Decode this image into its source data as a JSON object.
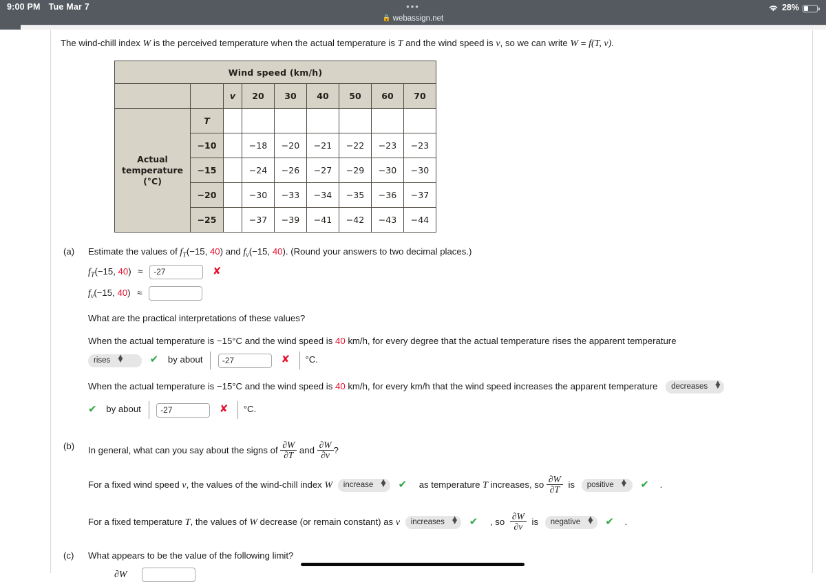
{
  "status_bar": {
    "time": "9:00 PM",
    "date": "Tue Mar 7",
    "battery_percent": "28%",
    "wifi_icon": "wifi-icon",
    "battery_icon": "battery-icon",
    "tab_overview_icon": "tab-overview-dots-icon"
  },
  "browser": {
    "url": "webassign.net",
    "lock_icon": "lock-icon"
  },
  "intro": {
    "part1": "The wind-chill index ",
    "W1": "W",
    "part2": " is the perceived temperature when the actual temperature is ",
    "T1": "T",
    "part3": " and the wind speed is ",
    "v1": "v",
    "part4": ", so we can write ",
    "W2": "W",
    "eq": " = ",
    "f1": "f",
    "args": "(T, v)",
    "period": "."
  },
  "table": {
    "title": "Wind speed (km/h)",
    "row_label": "Actual temperature (°C)",
    "row_label_line1": "Actual",
    "row_label_line2": "temperature",
    "row_label_line3": "(°C)",
    "v_symbol": "v",
    "T_symbol": "T",
    "speeds": [
      "20",
      "30",
      "40",
      "50",
      "60",
      "70"
    ],
    "temps": [
      "−10",
      "−15",
      "−20",
      "−25"
    ],
    "values": [
      [
        "−18",
        "−20",
        "−21",
        "−22",
        "−23",
        "−23"
      ],
      [
        "−24",
        "−26",
        "−27",
        "−29",
        "−30",
        "−30"
      ],
      [
        "−30",
        "−33",
        "−34",
        "−35",
        "−36",
        "−37"
      ],
      [
        "−37",
        "−39",
        "−41",
        "−42",
        "−43",
        "−44"
      ]
    ]
  },
  "part_a": {
    "label": "(a)",
    "prompt_pre": "Estimate the values of ",
    "fT_text": "f",
    "fT_sub": "T",
    "fT_args_open": "(−15, ",
    "fT_args_red": "40",
    "fT_args_close": ")",
    "prompt_mid": " and ",
    "fv_text": "f",
    "fv_sub": "v",
    "prompt_post": ". (Round your answers to two decimal places.)",
    "row1_lhs_f": "f",
    "row1_lhs_sub": "T",
    "row1_lhs_args_open": "(−15, ",
    "row1_lhs_args_red": "40",
    "row1_lhs_args_close": ")",
    "approx": "≈",
    "row1_value": "-27",
    "row1_mark": "✘",
    "row2_lhs_f": "f",
    "row2_lhs_sub": "v",
    "row2_value": "",
    "interp_question": "What are the practical interpretations of these values?",
    "interp1_pre": "When the actual temperature is −15°C and the wind speed is ",
    "interp1_red": "40",
    "interp1_post": " km/h, for every degree that the actual temperature rises the apparent temperature",
    "interp1_dropdown": "rises",
    "interp1_check": "✔",
    "interp1_by_about": "by about",
    "interp1_value": "-27",
    "interp1_mark": "✘",
    "interp1_unit": "°C.",
    "interp2_pre": "When the actual temperature is −15°C and the wind speed is ",
    "interp2_red": "40",
    "interp2_post": " km/h, for every km/h that the wind speed increases the apparent temperature",
    "interp2_dropdown": "decreases",
    "interp2_check": "✔",
    "interp2_by_about": "by about",
    "interp2_value": "-27",
    "interp2_mark": "✘",
    "interp2_unit": "°C."
  },
  "part_b": {
    "label": "(b)",
    "prompt_pre": "In general, what can you say about the signs of ",
    "frac1_num": "∂W",
    "frac1_den": "∂T",
    "prompt_and": " and ",
    "frac2_num": "∂W",
    "frac2_den": "∂v",
    "prompt_post": "?",
    "s1_pre": "For a fixed wind speed ",
    "s1_v": "v",
    "s1_mid": ", the values of the wind-chill index ",
    "s1_W": "W",
    "s1_dropdown": "increase",
    "s1_check": "✔",
    "s1_mid2": "as temperature ",
    "s1_T": "T",
    "s1_mid3": " increases, so ",
    "s1_frac_num": "∂W",
    "s1_frac_den": "∂T",
    "s1_is": "is",
    "s1_dropdown2": "positive",
    "s1_check2": "✔",
    "s1_period": ".",
    "s2_pre": "For a fixed temperature ",
    "s2_T": "T",
    "s2_mid": ", the values of ",
    "s2_W": "W",
    "s2_mid2": " decrease (or remain constant) as ",
    "s2_v": "v",
    "s2_dropdown": "increases",
    "s2_check": "✔",
    "s2_so": ", so",
    "s2_frac_num": "∂W",
    "s2_frac_den": "∂v",
    "s2_is": "is",
    "s2_dropdown2": "negative",
    "s2_check2": "✔",
    "s2_period": "."
  },
  "part_c": {
    "label": "(c)",
    "prompt": "What appears to be the value of the following limit?",
    "frac_num": "∂W",
    "value": ""
  },
  "colors": {
    "red": "#e8112d",
    "green": "#2ea844",
    "table_header": "#d7d3c7",
    "status_bar": "#545a60"
  }
}
